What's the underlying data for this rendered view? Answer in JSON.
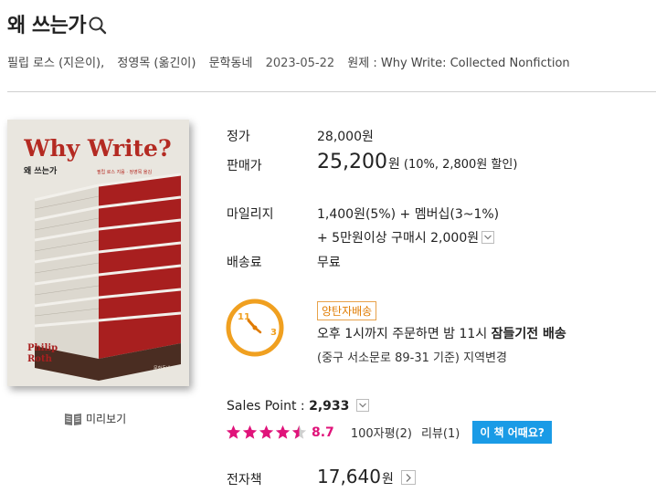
{
  "book": {
    "title": "왜 쓰는가",
    "author": "필립 로스 (지은이),",
    "translator": "정영목 (옮긴이)",
    "publisher": "문학동네",
    "date": "2023-05-22",
    "original": "원제 : Why Write: Collected Nonfiction"
  },
  "cover": {
    "title_en": "Why Write?",
    "title_ko": "왜 쓰는가",
    "credits": "필립 로스 지음 · 정영목 옮김",
    "author_en_line1": "Philip",
    "author_en_line2": "Roth",
    "publisher_mark": "문학동네"
  },
  "preview": {
    "label": "미리보기"
  },
  "price": {
    "list_label": "정가",
    "list_value": "28,000원",
    "sale_label": "판매가",
    "sale_value": "25,200",
    "sale_unit": "원",
    "discount": "(10%, 2,800원 할인)"
  },
  "mileage": {
    "label": "마일리지",
    "line1": "1,400원(5%) + 멤버십(3~1%)",
    "line2": "+ 5만원이상 구매시 2,000원"
  },
  "shipping": {
    "label": "배송료",
    "value": "무료"
  },
  "delivery": {
    "tag": "양탄자배송",
    "line1_prefix": "오후 1시까지 주문하면 밤 11시 ",
    "line1_bold": "잠들기전 배송",
    "line2": "(중구 서소문로 89-31 기준) 지역변경",
    "clock_left": "11",
    "clock_right": "3"
  },
  "sales_point": {
    "label": "Sales Point : ",
    "value": "2,933"
  },
  "rating": {
    "score": "8.7",
    "stars": 4.5,
    "short_reviews": "100자평(2)",
    "reviews": "리뷰(1)",
    "ask_button": "이 책 어때요?"
  },
  "ebook": {
    "label": "전자책",
    "price": "17,640",
    "unit": "원"
  },
  "colors": {
    "accent_pink": "#e0137a",
    "button_blue": "#1a9be6",
    "clock_orange": "#f0a020",
    "tag_orange": "#e07b00"
  }
}
